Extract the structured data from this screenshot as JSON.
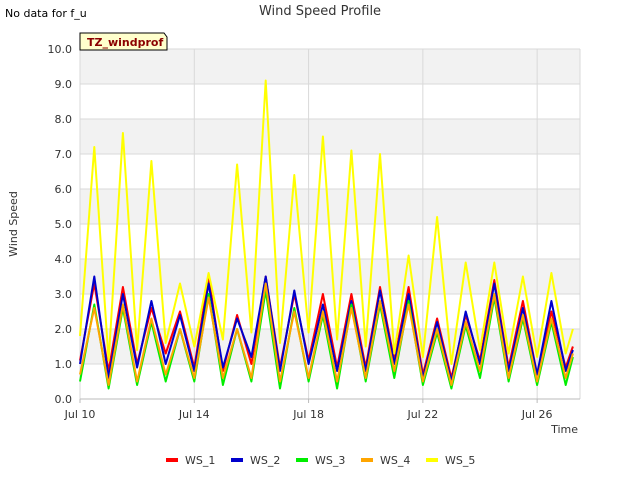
{
  "note": "No data for f_u",
  "site_label": "TZ_windprof",
  "colors": {
    "plot_band": "#f2f2f2",
    "grid": "#d9d9d9",
    "site_label_bg": "#ffffcc",
    "site_label_text": "#8b0000"
  },
  "chart_data": {
    "type": "line",
    "title": "Wind Speed Profile",
    "xlabel": "Time",
    "ylabel": "Wind Speed",
    "ylim": [
      0,
      10
    ],
    "xlim": [
      "2024-07-10",
      "2024-07-27T12:00"
    ],
    "yticks": [
      "0.0",
      "1.0",
      "2.0",
      "3.0",
      "4.0",
      "5.0",
      "6.0",
      "7.0",
      "8.0",
      "9.0",
      "10.0"
    ],
    "xticks": [
      {
        "date": "2024-07-10",
        "label": "Jul 10"
      },
      {
        "date": "2024-07-14",
        "label": "Jul 14"
      },
      {
        "date": "2024-07-18",
        "label": "Jul 18"
      },
      {
        "date": "2024-07-22",
        "label": "Jul 22"
      },
      {
        "date": "2024-07-26",
        "label": "Jul 26"
      }
    ],
    "grid": true,
    "legend_position": "bottom",
    "x": [
      "2024-07-10",
      "2024-07-10T12:00",
      "2024-07-11",
      "2024-07-11T12:00",
      "2024-07-12",
      "2024-07-12T12:00",
      "2024-07-13",
      "2024-07-13T12:00",
      "2024-07-14",
      "2024-07-14T12:00",
      "2024-07-15",
      "2024-07-15T12:00",
      "2024-07-16",
      "2024-07-16T12:00",
      "2024-07-17",
      "2024-07-17T12:00",
      "2024-07-18",
      "2024-07-18T12:00",
      "2024-07-19",
      "2024-07-19T12:00",
      "2024-07-20",
      "2024-07-20T12:00",
      "2024-07-21",
      "2024-07-21T12:00",
      "2024-07-22",
      "2024-07-22T12:00",
      "2024-07-23",
      "2024-07-23T12:00",
      "2024-07-24",
      "2024-07-24T12:00",
      "2024-07-25",
      "2024-07-25T12:00",
      "2024-07-26",
      "2024-07-26T12:00",
      "2024-07-27",
      "2024-07-27T06:00"
    ],
    "series": [
      {
        "name": "WS_1",
        "color": "#ff0000",
        "values": [
          1.1,
          3.3,
          0.8,
          3.2,
          1.0,
          2.6,
          1.3,
          2.5,
          0.9,
          3.5,
          0.8,
          2.4,
          1.0,
          3.5,
          0.9,
          3.0,
          1.1,
          3.0,
          0.9,
          3.0,
          0.9,
          3.2,
          1.1,
          3.2,
          0.7,
          2.3,
          0.6,
          2.4,
          1.1,
          3.4,
          0.9,
          2.8,
          0.7,
          2.5,
          0.9,
          1.5
        ]
      },
      {
        "name": "WS_2",
        "color": "#0000cc",
        "values": [
          1.0,
          3.5,
          0.6,
          3.0,
          0.9,
          2.8,
          1.0,
          2.4,
          0.8,
          3.3,
          0.9,
          2.3,
          1.2,
          3.5,
          0.8,
          3.1,
          1.0,
          2.7,
          0.8,
          2.8,
          0.8,
          3.1,
          1.0,
          3.0,
          0.6,
          2.2,
          0.5,
          2.5,
          1.0,
          3.3,
          0.8,
          2.6,
          0.7,
          2.8,
          0.8,
          1.4
        ]
      },
      {
        "name": "WS_3",
        "color": "#00ee00",
        "values": [
          0.5,
          2.7,
          0.3,
          2.6,
          0.4,
          2.2,
          0.5,
          2.0,
          0.5,
          3.0,
          0.4,
          2.0,
          0.5,
          3.1,
          0.3,
          2.6,
          0.5,
          2.4,
          0.3,
          2.7,
          0.5,
          2.7,
          0.6,
          2.8,
          0.4,
          1.9,
          0.3,
          2.1,
          0.6,
          2.9,
          0.5,
          2.3,
          0.4,
          2.2,
          0.4,
          1.2
        ]
      },
      {
        "name": "WS_4",
        "color": "#ffa500",
        "values": [
          0.7,
          2.6,
          0.4,
          2.7,
          0.5,
          2.3,
          0.7,
          2.0,
          0.6,
          2.9,
          0.6,
          2.0,
          0.6,
          3.3,
          0.5,
          2.5,
          0.6,
          2.5,
          0.5,
          2.6,
          0.6,
          2.8,
          0.8,
          2.7,
          0.5,
          2.0,
          0.4,
          2.2,
          0.8,
          3.0,
          0.6,
          2.4,
          0.5,
          2.3,
          0.6,
          1.3
        ]
      },
      {
        "name": "WS_5",
        "color": "#ffff00",
        "values": [
          1.8,
          7.2,
          1.1,
          7.6,
          1.4,
          6.8,
          1.6,
          3.3,
          1.5,
          3.6,
          1.7,
          6.7,
          1.9,
          9.1,
          1.6,
          6.4,
          1.9,
          7.5,
          1.7,
          7.1,
          1.5,
          7.0,
          1.3,
          4.1,
          1.2,
          5.2,
          1.0,
          3.9,
          1.4,
          3.9,
          1.3,
          3.5,
          1.2,
          3.6,
          1.3,
          2.0
        ]
      }
    ]
  }
}
